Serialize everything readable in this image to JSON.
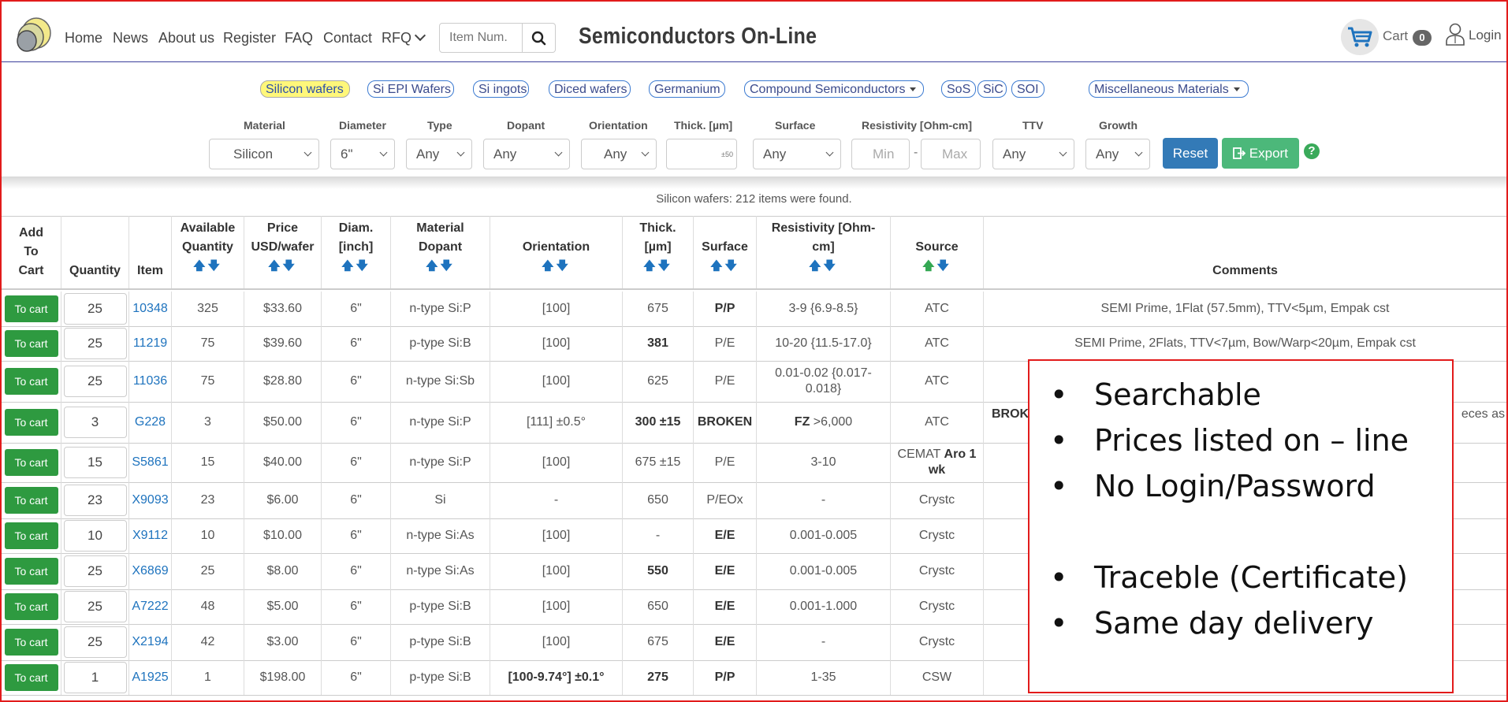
{
  "nav": {
    "links": [
      "Home",
      "News",
      "About us",
      "Register",
      "FAQ",
      "Contact",
      "RFQ"
    ],
    "search_placeholder": "Item Num.",
    "brand": "Semiconductors On-Line",
    "cart_label": "Cart",
    "cart_count": "0",
    "login_label": "Login"
  },
  "categories": [
    {
      "label": "Silicon wafers",
      "active": true,
      "dropdown": false
    },
    {
      "label": "Si EPI Wafers",
      "dropdown": false
    },
    {
      "label": "Si ingots",
      "dropdown": false
    },
    {
      "label": "Diced wafers",
      "dropdown": false
    },
    {
      "label": "Germanium",
      "dropdown": false
    },
    {
      "label": "Compound Semiconductors",
      "dropdown": true
    },
    {
      "label": "SoS",
      "dropdown": false
    },
    {
      "label": "SiC",
      "dropdown": false
    },
    {
      "label": "SOI",
      "dropdown": false
    },
    {
      "label": "Miscellaneous Materials",
      "dropdown": true
    }
  ],
  "filters": {
    "labels": [
      "Material",
      "Diameter",
      "Type",
      "Dopant",
      "Orientation",
      "Thick. [µm]",
      "Surface",
      "Resistivity [Ohm-cm]",
      "TTV",
      "Growth"
    ],
    "material": "Silicon",
    "diameter": "6\"",
    "type": "Any",
    "dopant": "Any",
    "orientation": "Any",
    "thick_tolerance": "±50",
    "surface": "Any",
    "res_min_placeholder": "Min",
    "res_sep": "-",
    "res_max_placeholder": "Max",
    "ttv": "Any",
    "growth": "Any",
    "reset_label": "Reset",
    "export_label": "Export",
    "help": "?"
  },
  "found_text": "Silicon wafers: 212 items were found.",
  "table": {
    "headers": {
      "add": [
        "Add",
        "To",
        "Cart"
      ],
      "quantity": "Quantity",
      "item": "Item",
      "available": [
        "Available",
        "Quantity"
      ],
      "price": [
        "Price",
        "USD/wafer"
      ],
      "diam": [
        "Diam.",
        "[inch]"
      ],
      "material": [
        "Material",
        "Dopant"
      ],
      "orientation": "Orientation",
      "thick": [
        "Thick.",
        "[µm]"
      ],
      "surface": "Surface",
      "resistivity": [
        "Resistivity [Ohm-",
        "cm]"
      ],
      "source": "Source",
      "comments": "Comments"
    },
    "cart_button": "To cart",
    "rows": [
      {
        "qty": "25",
        "item": "10348",
        "avail": "325",
        "price": "$33.60",
        "diam": "6\"",
        "dopant": "n-type Si:P",
        "orient": "[100]",
        "thick": "675",
        "surface": "P/P",
        "res": "3-9 {6.9-8.5}",
        "source": "ATC",
        "comment": "SEMI Prime, 1Flat (57.5mm), TTV<5µm, Empak cst"
      },
      {
        "qty": "25",
        "item": "11219",
        "avail": "75",
        "price": "$39.60",
        "diam": "6\"",
        "dopant": "p-type Si:B",
        "orient": "[100]",
        "thick": "381",
        "surface": "P/E",
        "res": "10-20 {11.5-17.0}",
        "source": "ATC",
        "comment": "SEMI Prime, 2Flats, TTV<7µm, Bow/Warp<20µm, Empak cst"
      },
      {
        "qty": "25",
        "item": "11036",
        "avail": "75",
        "price": "$28.80",
        "diam": "6\"",
        "dopant": "n-type Si:Sb",
        "orient": "[100]",
        "thick": "625",
        "surface": "P/E",
        "res": "0.01-0.02 {0.017-0.018}",
        "source": "ATC",
        "comment": ""
      },
      {
        "qty": "3",
        "item": "G228",
        "avail": "3",
        "price": "$50.00",
        "diam": "6\"",
        "dopant": "n-type Si:P",
        "orient": "[111] ±0.5°",
        "thick": "300 ±15",
        "surface": "BROKEN",
        "res_bold": "FZ",
        "res": ">6,000",
        "source": "ATC",
        "comment": "BROK",
        "comment_tail": "eces as"
      },
      {
        "qty": "15",
        "item": "S5861",
        "avail": "15",
        "price": "$40.00",
        "diam": "6\"",
        "dopant": "n-type Si:P",
        "orient": "[100]",
        "thick": "675 ±15",
        "surface": "P/E",
        "res": "3-10",
        "source": "CEMAT",
        "source_bold": "Aro 1 wk",
        "comment": ""
      },
      {
        "qty": "23",
        "item": "X9093",
        "avail": "23",
        "price": "$6.00",
        "diam": "6\"",
        "dopant": "Si",
        "orient": "-",
        "thick": "650",
        "surface": "P/EOx",
        "res": "-",
        "source": "Crystc",
        "comment": ""
      },
      {
        "qty": "10",
        "item": "X9112",
        "avail": "10",
        "price": "$10.00",
        "diam": "6\"",
        "dopant": "n-type Si:As",
        "orient": "[100]",
        "thick": "-",
        "surface": "E/E",
        "res": "0.001-0.005",
        "source": "Crystc",
        "comment": ""
      },
      {
        "qty": "25",
        "item": "X6869",
        "avail": "25",
        "price": "$8.00",
        "diam": "6\"",
        "dopant": "n-type Si:As",
        "orient": "[100]",
        "thick": "550",
        "surface": "E/E",
        "res": "0.001-0.005",
        "source": "Crystc",
        "comment": ""
      },
      {
        "qty": "25",
        "item": "A7222",
        "avail": "48",
        "price": "$5.00",
        "diam": "6\"",
        "dopant": "p-type Si:B",
        "orient": "[100]",
        "thick": "650",
        "surface": "E/E",
        "res": "0.001-1.000",
        "source": "Crystc",
        "comment": ""
      },
      {
        "qty": "25",
        "item": "X2194",
        "avail": "42",
        "price": "$3.00",
        "diam": "6\"",
        "dopant": "p-type Si:B",
        "orient": "[100]",
        "thick": "675",
        "surface": "E/E",
        "res": "-",
        "source": "Crystc",
        "comment": ""
      },
      {
        "qty": "1",
        "item": "A1925",
        "avail": "1",
        "price": "$198.00",
        "diam": "6\"",
        "dopant": "p-type Si:B",
        "orient": "[100-9.74°] ±0.1°",
        "thick": "275",
        "surface": "P/P",
        "res": "1-35",
        "source": "CSW",
        "comment": ""
      }
    ]
  },
  "callout": {
    "items": [
      "Searchable",
      "Prices listed on – line",
      "No Login/Password",
      "",
      "Traceble (Certificate)",
      "Same day delivery"
    ]
  },
  "colors": {
    "accent": "#1e73be",
    "cart_button": "#2e9a40",
    "reset": "#337ab7",
    "export": "#4cb87a",
    "callout_border": "#e21b1b",
    "active_category": "#fff77a"
  }
}
